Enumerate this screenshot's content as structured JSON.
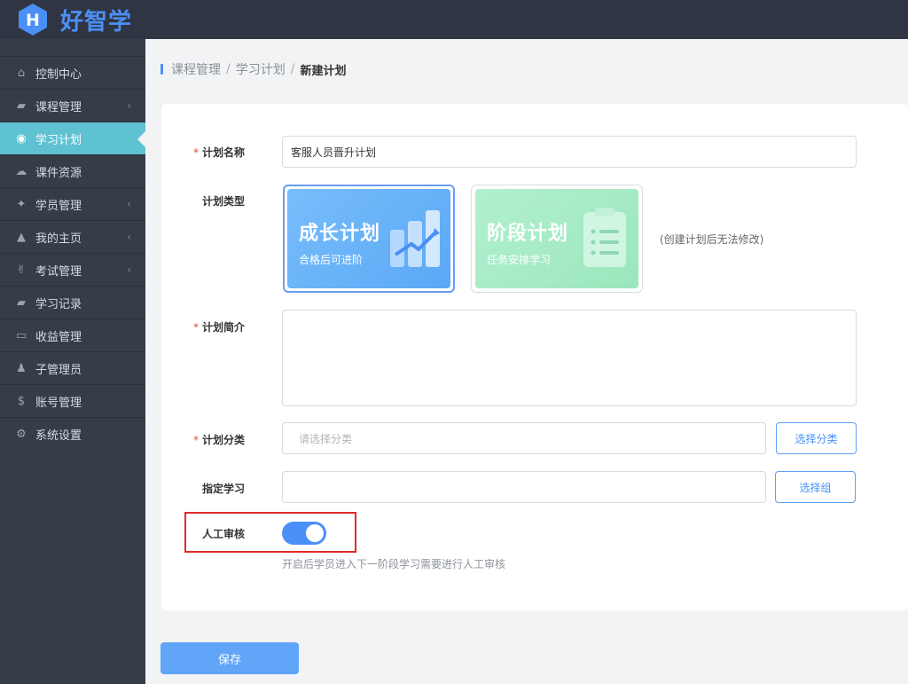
{
  "app": {
    "logo_letter": "H",
    "name": "好智学"
  },
  "sidebar": {
    "items": [
      {
        "label": "控制中心",
        "icon": "home-icon",
        "glyph": "⌂",
        "arrow": false,
        "active": false
      },
      {
        "label": "课程管理",
        "icon": "book-icon",
        "glyph": "▰",
        "arrow": true,
        "active": false
      },
      {
        "label": "学习计划",
        "icon": "eye-icon",
        "glyph": "◉",
        "arrow": false,
        "active": true
      },
      {
        "label": "课件资源",
        "icon": "cloud-upload-icon",
        "glyph": "☁",
        "arrow": false,
        "active": false
      },
      {
        "label": "学员管理",
        "icon": "users-icon",
        "glyph": "✦",
        "arrow": true,
        "active": false
      },
      {
        "label": "我的主页",
        "icon": "graduation-cap-icon",
        "glyph": "▲",
        "arrow": true,
        "active": false
      },
      {
        "label": "考试管理",
        "icon": "thumbs-up-icon",
        "glyph": "✌",
        "arrow": true,
        "active": false
      },
      {
        "label": "学习记录",
        "icon": "book-icon",
        "glyph": "▰",
        "arrow": false,
        "active": false
      },
      {
        "label": "收益管理",
        "icon": "credit-card-icon",
        "glyph": "▭",
        "arrow": false,
        "active": false
      },
      {
        "label": "子管理员",
        "icon": "user-icon",
        "glyph": "♟",
        "arrow": false,
        "active": false
      },
      {
        "label": "账号管理",
        "icon": "dollar-icon",
        "glyph": "$",
        "arrow": false,
        "active": false
      },
      {
        "label": "系统设置",
        "icon": "gear-icon",
        "glyph": "⚙",
        "arrow": false,
        "active": false
      }
    ],
    "arrow_glyph": "‹"
  },
  "breadcrumb": {
    "items": [
      "课程管理",
      "学习计划"
    ],
    "separator": "/",
    "current": "新建计划"
  },
  "form": {
    "required_mark": "*",
    "name": {
      "label": "计划名称",
      "value": "客服人员晋升计划"
    },
    "type": {
      "label": "计划类型",
      "options": [
        {
          "title": "成长计划",
          "subtitle": "合格后可进阶",
          "selected": true
        },
        {
          "title": "阶段计划",
          "subtitle": "任务安排学习",
          "selected": false
        }
      ],
      "note": "(创建计划后无法修改)"
    },
    "intro": {
      "label": "计划简介",
      "value": ""
    },
    "category": {
      "label": "计划分类",
      "placeholder": "请选择分类",
      "button": "选择分类"
    },
    "assign": {
      "label": "指定学习",
      "value": "",
      "button": "选择组"
    },
    "review": {
      "label": "人工审核",
      "enabled": true,
      "hint": "开启后学员进入下一阶段学习需要进行人工审核"
    },
    "save": "保存"
  },
  "colors": {
    "primary": "#4a90f7",
    "sidebar_bg": "#353d49",
    "sidebar_active": "#5ec2d2",
    "growth_card": "#6cb6f9",
    "stage_card": "#a7ecc4",
    "required": "#e1483d",
    "highlight": "#e02a2a"
  }
}
